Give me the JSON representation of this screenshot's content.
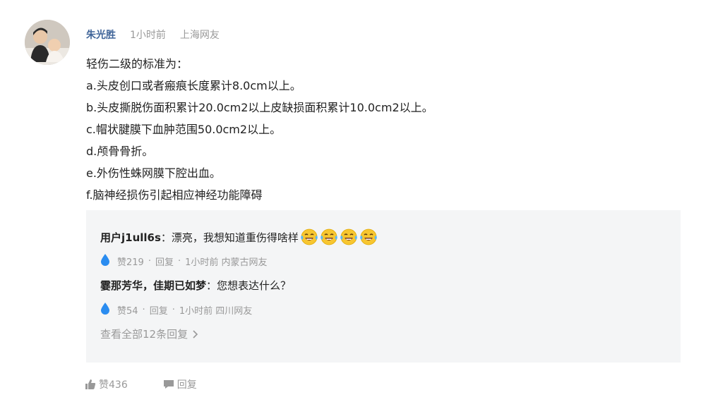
{
  "comment": {
    "username": "朱光胜",
    "time": "1小时前",
    "location": "上海网友",
    "content_lines": [
      "轻伤二级的标准为：",
      "a.头皮创口或者瘢痕长度累计8.0cm以上。",
      "b.头皮撕脱伤面积累计20.0cm2以上皮缺损面积累计10.0cm2以上。",
      "c.帽状腱膜下血肿范围50.0cm2以上。",
      "d.颅骨骨折。",
      "e.外伤性蛛网膜下腔出血。",
      "f.脑神经损伤引起相应神经功能障碍"
    ],
    "likes": "赞436",
    "reply_label": "回复"
  },
  "replies": [
    {
      "name": "用户j1ull6s",
      "text": "：漂亮，我想知道重伤得啥样",
      "emoji_count": 4,
      "likes": "赞219",
      "reply_label": "回复",
      "time_location": "1小时前 内蒙古网友"
    },
    {
      "name": "霎那芳华，佳期已如梦",
      "text": "：您想表达什么？",
      "likes": "赞54",
      "reply_label": "回复",
      "time_location": "1小时前 四川网友"
    }
  ],
  "view_all": "查看全部12条回复",
  "colors": {
    "username": "#406599",
    "meta_gray": "#999999",
    "reply_bg": "#f4f5f6",
    "drop_blue": "#2a8cf0"
  }
}
